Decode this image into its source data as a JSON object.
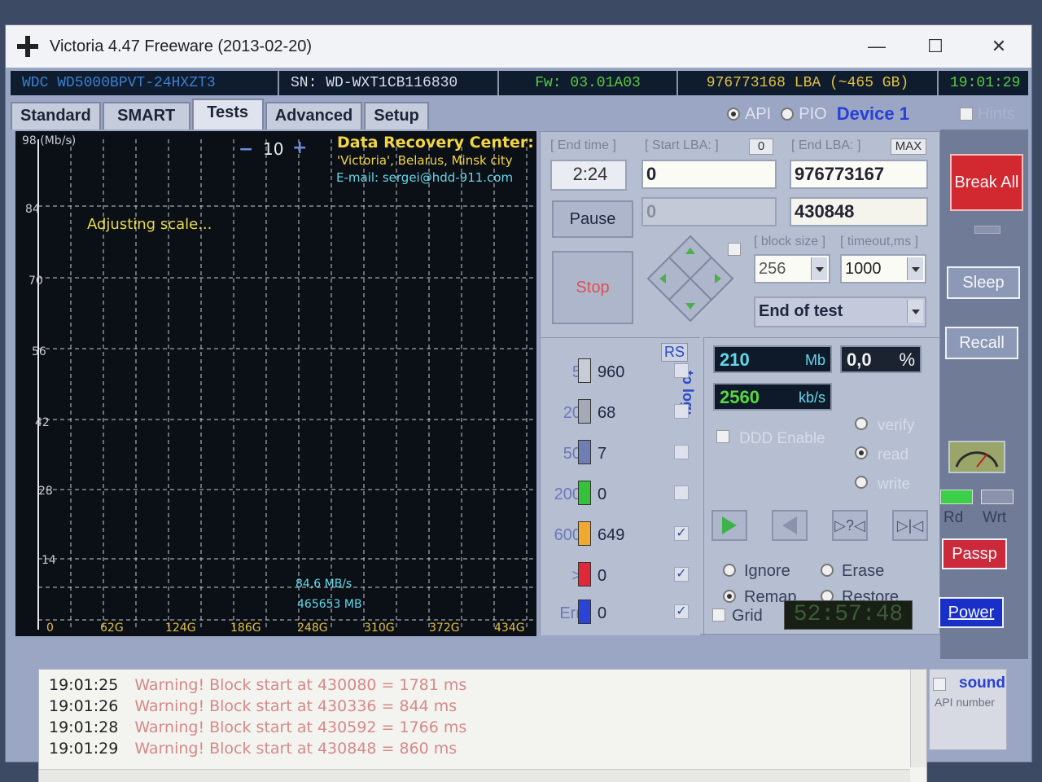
{
  "window": {
    "title": "Victoria 4.47  Freeware (2013-02-20)",
    "min": "—",
    "max": "☐",
    "close": "✕"
  },
  "infobar": {
    "model": "WDC WD5000BPVT-24HXZT3",
    "serial": "SN: WD-WXT1CB116830",
    "firmware": "Fw: 03.01A03",
    "lba": "976773168 LBA (~465 GB)",
    "clock": "19:01:29"
  },
  "tabs": [
    "Standard",
    "SMART",
    "Tests",
    "Advanced",
    "Setup"
  ],
  "api_bar": {
    "api": "API",
    "pio": "PIO",
    "device": "Device 1",
    "hints": "Hints"
  },
  "graph": {
    "unit": "98 (Mb/s)",
    "y_ticks": [
      "84",
      "70",
      "56",
      "42",
      "28",
      "14"
    ],
    "x_ticks": [
      "0",
      "62G",
      "124G",
      "186G",
      "248G",
      "310G",
      "372G",
      "434G"
    ],
    "scale_minus": "−",
    "scale_value": "10",
    "scale_plus": "+",
    "adjusting": "Adjusting scale...",
    "drc_title": "Data Recovery Center:",
    "drc_line1": "'Victoria', Belarus, Minsk city",
    "drc_line2": "E-mail: sergei@hdd-911.com",
    "speed": "84,6 MB/s",
    "position": "465653 MB"
  },
  "test_panel": {
    "end_time_label": "[ End time ]",
    "end_time": "2:24",
    "start_lba_label": "[ Start LBA: ]",
    "start_lba_btn": "0",
    "start_lba": "0",
    "current_lba": "0",
    "end_lba_label": "[ End LBA: ]",
    "end_lba_btn": "MAX",
    "end_lba": "976773167",
    "current_end": "430848",
    "pause": "Pause",
    "stop": "Stop",
    "block_size_label": "[ block size ]",
    "block_size": "256",
    "timeout_label": "[ timeout,ms ]",
    "timeout": "1000",
    "end_action": "End of test",
    "rs": "RS",
    "to_log": "to log:"
  },
  "blocks": [
    {
      "thr": "5",
      "count": "960",
      "color": "#c8ccd6",
      "logged": ""
    },
    {
      "thr": "20",
      "count": "68",
      "color": "#a4a9b6",
      "logged": ""
    },
    {
      "thr": "50",
      "count": "7",
      "color": "#6f7fb6",
      "logged": ""
    },
    {
      "thr": "200",
      "count": "0",
      "color": "#35c23a",
      "logged": ""
    },
    {
      "thr": "600",
      "count": "649",
      "color": "#f0a830",
      "logged": "✓"
    },
    {
      "thr": ">",
      "count": "0",
      "color": "#e0283a",
      "logged": "✓"
    },
    {
      "thr": "Err",
      "count": "0",
      "color": "#2a44d8",
      "logged": "✓"
    }
  ],
  "stats": {
    "mb": "210",
    "mb_unit": "Mb",
    "percent": "0,0",
    "percent_unit": "%",
    "speed": "2560",
    "speed_unit": "kb/s",
    "ddd": "DDD Enable",
    "verify": "verify",
    "read": "read",
    "write": "write"
  },
  "modes": {
    "ignore": "Ignore",
    "erase": "Erase",
    "remap": "Remap",
    "restore": "Restore",
    "grid": "Grid",
    "timer": "52:57:48"
  },
  "sidebar": {
    "break_all": "Break All",
    "sleep": "Sleep",
    "recall": "Recall",
    "rd": "Rd",
    "wrt": "Wrt",
    "passp": "Passp",
    "power": "Power",
    "sound": "sound",
    "api_number": "API number"
  },
  "log": [
    {
      "time": "19:01:25",
      "msg": "Warning! Block start at 430080 = 1781 ms"
    },
    {
      "time": "19:01:26",
      "msg": "Warning! Block start at 430336 = 844 ms"
    },
    {
      "time": "19:01:28",
      "msg": "Warning! Block start at 430592 = 1766 ms"
    },
    {
      "time": "19:01:29",
      "msg": "Warning! Block start at 430848 = 860 ms"
    }
  ]
}
